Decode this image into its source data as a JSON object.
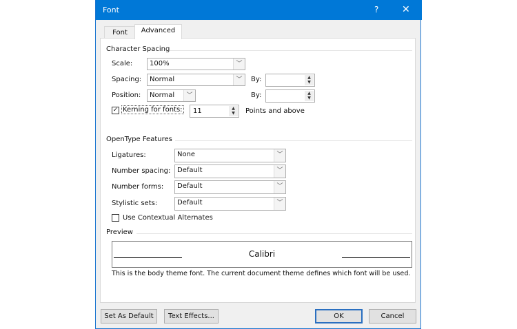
{
  "title": "Font",
  "help": "?",
  "close": "✕",
  "tabs": [
    "Font",
    "Advanced"
  ],
  "character_spacing": {
    "heading": "Character Spacing",
    "scale_label": "Scale:",
    "scale_value": "100%",
    "spacing_label": "Spacing:",
    "spacing_value": "Normal",
    "spacing_by_label": "By:",
    "spacing_by_value": "",
    "position_label": "Position:",
    "position_value": "Normal",
    "position_by_label": "By:",
    "position_by_value": "",
    "kerning_label": "Kerning for fonts:",
    "kerning_checked": true,
    "kerning_value": "11",
    "kerning_suffix": "Points and above"
  },
  "opentype": {
    "heading": "OpenType Features",
    "ligatures_label": "Ligatures:",
    "ligatures_value": "None",
    "number_spacing_label": "Number spacing:",
    "number_spacing_value": "Default",
    "number_forms_label": "Number forms:",
    "number_forms_value": "Default",
    "stylistic_sets_label": "Stylistic sets:",
    "stylistic_sets_value": "Default",
    "contextual_label": "Use Contextual Alternates",
    "contextual_checked": false
  },
  "preview": {
    "heading": "Preview",
    "sample": "Calibri",
    "description": "This is the body theme font. The current document theme defines which font will be used."
  },
  "buttons": {
    "set_default": "Set As Default",
    "text_effects": "Text Effects...",
    "ok": "OK",
    "cancel": "Cancel"
  },
  "colors": {
    "title_bar": "#0078d7"
  }
}
